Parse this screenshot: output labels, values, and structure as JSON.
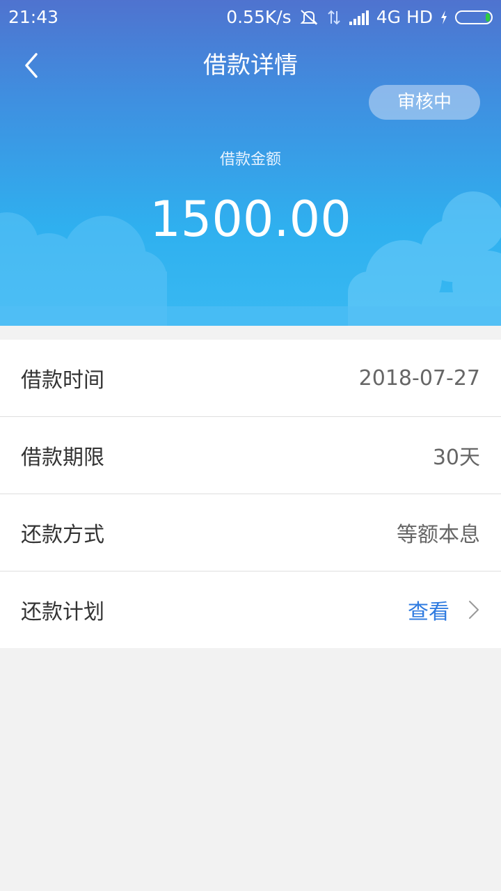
{
  "status_bar": {
    "time": "21:43",
    "net_speed": "0.55K/s",
    "network": "4G HD"
  },
  "header": {
    "title": "借款详情",
    "status_badge": "审核中"
  },
  "loan": {
    "amount_label": "借款金额",
    "amount_value": "1500.00"
  },
  "details": {
    "rows": [
      {
        "label": "借款时间",
        "value": "2018-07-27"
      },
      {
        "label": "借款期限",
        "value": "30天"
      },
      {
        "label": "还款方式",
        "value": "等额本息"
      },
      {
        "label": "还款计划",
        "value": "查看"
      }
    ]
  },
  "colors": {
    "header_top": "#4f73cf",
    "header_bottom": "#39b9f2",
    "link": "#2f7be0",
    "background": "#f2f2f2"
  },
  "icons": {
    "back": "chevron-left-icon",
    "row_arrow": "chevron-right-icon"
  }
}
